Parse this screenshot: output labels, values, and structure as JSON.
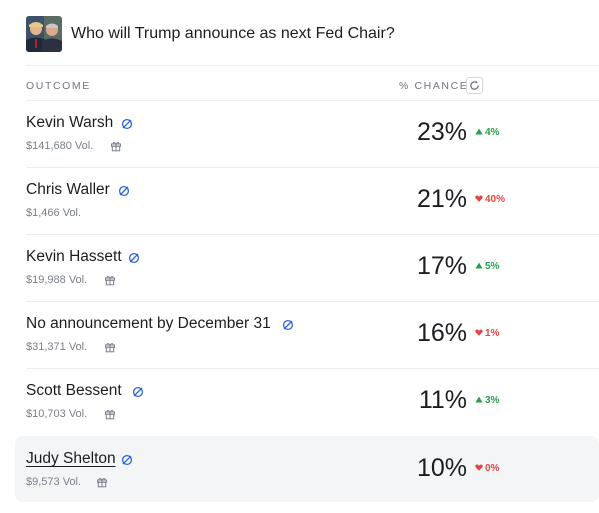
{
  "market": {
    "title": "Who will Trump announce as next Fed Chair?"
  },
  "columns": {
    "outcome": "OUTCOME",
    "chance": "% CHANCE"
  },
  "colors": {
    "up": "#27a14b",
    "down": "#e2463f",
    "verify": "#2d66d6"
  },
  "outcomes": [
    {
      "name": "Kevin Warsh",
      "volume": "$141,680 Vol.",
      "chance": "23%",
      "change": "4%",
      "direction": "up",
      "gift": true
    },
    {
      "name": "Chris Waller",
      "volume": "$1,466 Vol.",
      "chance": "21%",
      "change": "40%",
      "direction": "down",
      "gift": false
    },
    {
      "name": "Kevin Hassett",
      "volume": "$19,988 Vol.",
      "chance": "17%",
      "change": "5%",
      "direction": "up",
      "gift": true
    },
    {
      "name": "No announcement by December 31",
      "volume": "$31,371 Vol.",
      "chance": "16%",
      "change": "1%",
      "direction": "down",
      "gift": true
    },
    {
      "name": "Scott Bessent",
      "volume": "$10,703 Vol.",
      "chance": "11%",
      "change": "3%",
      "direction": "up",
      "gift": true
    },
    {
      "name": "Judy Shelton",
      "volume": "$9,573 Vol.",
      "chance": "10%",
      "change": "0%",
      "direction": "down",
      "gift": true
    }
  ]
}
